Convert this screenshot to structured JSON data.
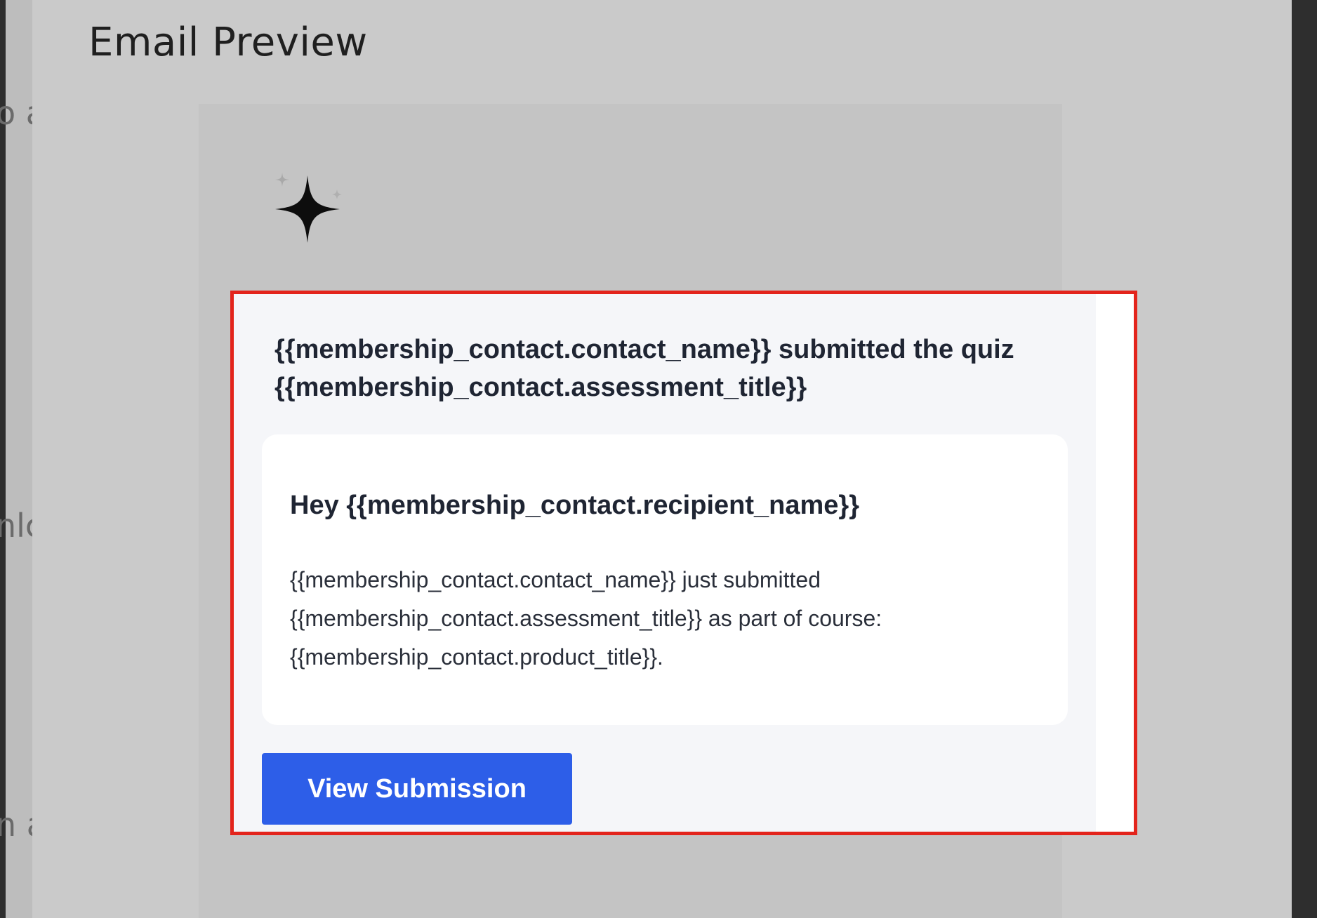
{
  "modal": {
    "title": "Email Preview"
  },
  "background_fragments": [
    "o a",
    "nlc",
    "n a"
  ],
  "email": {
    "headline": "{{membership_contact.contact_name}} submitted the quiz {{membership_contact.assessment_title}}",
    "greeting": "Hey {{membership_contact.recipient_name}}",
    "body": "{{membership_contact.contact_name}} just submitted {{membership_contact.assessment_title}} as part of course: {{membership_contact.product_title}}.",
    "button_label": "View Submission",
    "logo_icon": "sparkle-icon"
  },
  "colors": {
    "highlight_border": "#e3241c",
    "button": "#2d5ee8"
  }
}
